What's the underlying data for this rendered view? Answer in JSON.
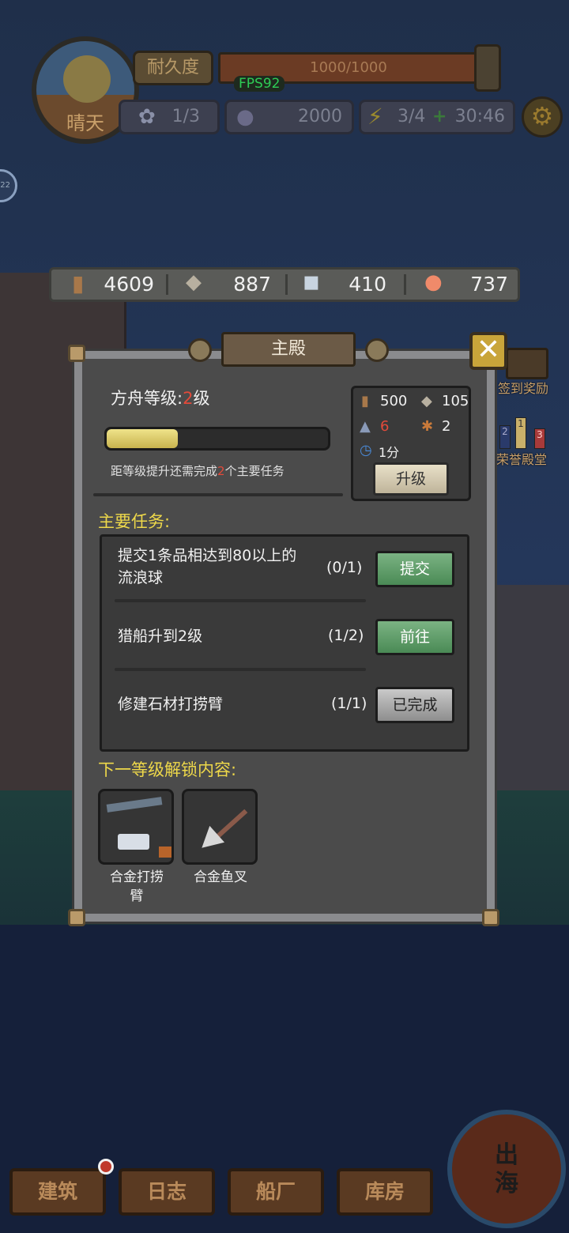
{
  "hud": {
    "weather": "晴天",
    "durability_label": "耐久度",
    "durability_value": "1000/1000",
    "fps": "FPS92",
    "crew": "1/3",
    "coins": "2000",
    "energy": "3/4",
    "energy_plus": "+",
    "timer": "30:46",
    "side_bubble": "22"
  },
  "resources": {
    "wood": "4609",
    "stone": "887",
    "metal": "410",
    "fish": "737"
  },
  "side_hints": {
    "sign_reward": "签到奖励",
    "hall": "荣誉殿堂",
    "podium": [
      "2",
      "1",
      "3"
    ]
  },
  "modal": {
    "title": "主殿",
    "close": "✕",
    "level_prefix": "方舟等级:",
    "level_value": "2",
    "level_suffix": "级",
    "progress": 0.32,
    "req_prefix": "距等级提升还需完成",
    "req_value": "2",
    "req_suffix": "个主要任务",
    "cost": {
      "wood": "500",
      "stone": "105",
      "metal": "6",
      "rope": "2",
      "time": "1分"
    },
    "upgrade_label": "升级",
    "tasks_title": "主要任务:",
    "tasks": [
      {
        "name_line1": "提交1条品相达到80以上的",
        "name_line2": "流浪球",
        "progress": "(0/1)",
        "button": "提交"
      },
      {
        "name_line1": "猎船升到2级",
        "name_line2": "",
        "progress": "(1/2)",
        "button": "前往"
      },
      {
        "name_line1": "修建石材打捞臂",
        "name_line2": "",
        "progress": "(1/1)",
        "button": "已完成"
      }
    ],
    "unlock_title": "下一等级解锁内容:",
    "unlocks": [
      {
        "label_line1": "合金打捞",
        "label_line2": "臂"
      },
      {
        "label_line1": "合金鱼叉",
        "label_line2": ""
      }
    ]
  },
  "nav": {
    "build": "建筑",
    "log": "日志",
    "shipyard": "船厂",
    "storage": "库房",
    "sea_line1": "出",
    "sea_line2": "海"
  },
  "colors": {
    "accent_yellow": "#eed84a",
    "highlight_red": "#e34a3a",
    "button_green": "#4a8a55"
  }
}
